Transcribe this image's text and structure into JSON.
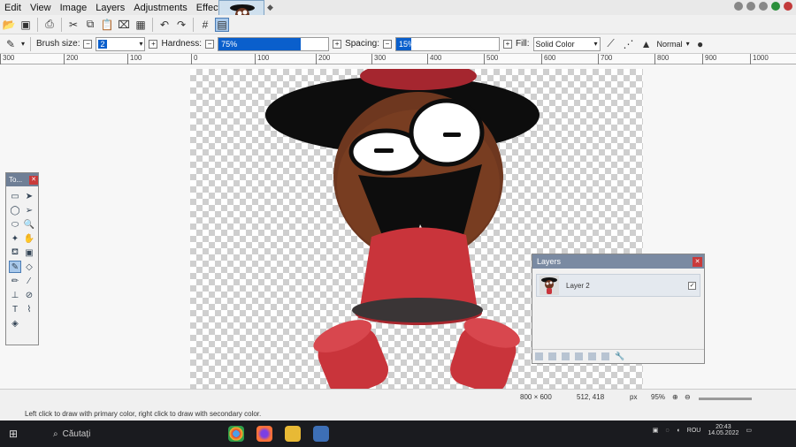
{
  "menu": {
    "items": [
      "Edit",
      "View",
      "Image",
      "Layers",
      "Adjustments",
      "Effects"
    ]
  },
  "toolbar": {
    "brush_size_label": "Brush size:",
    "brush_size_value": "2",
    "hardness_label": "Hardness:",
    "hardness_value": "75%",
    "hardness_fraction": 0.75,
    "spacing_label": "Spacing:",
    "spacing_value": "15%",
    "spacing_fraction": 0.15,
    "fill_label": "Fill:",
    "fill_value": "Solid Color",
    "blend_mode": "Normal"
  },
  "ruler": {
    "ticks": [
      "300",
      "200",
      "100",
      "0",
      "100",
      "200",
      "300",
      "400",
      "500",
      "600",
      "700",
      "800",
      "900",
      "1000"
    ]
  },
  "tools_window": {
    "title": "To..."
  },
  "layers_window": {
    "title": "Layers",
    "layer_name": "Layer 2"
  },
  "status": {
    "hint": "Left click to draw with primary color, right click to draw with secondary color.",
    "image_size": "800 × 600",
    "cursor_pos": "512, 418",
    "units": "px",
    "zoom": "95%"
  },
  "taskbar": {
    "search_placeholder": "Căutați",
    "language": "ROU",
    "time": "20:43",
    "date": "14.05.2022"
  },
  "colors": {
    "accent": "#0a5fcc",
    "hat": "#0d0d0d",
    "face": "#7a3e22",
    "body": "#c9343b",
    "base": "#3a3536"
  }
}
